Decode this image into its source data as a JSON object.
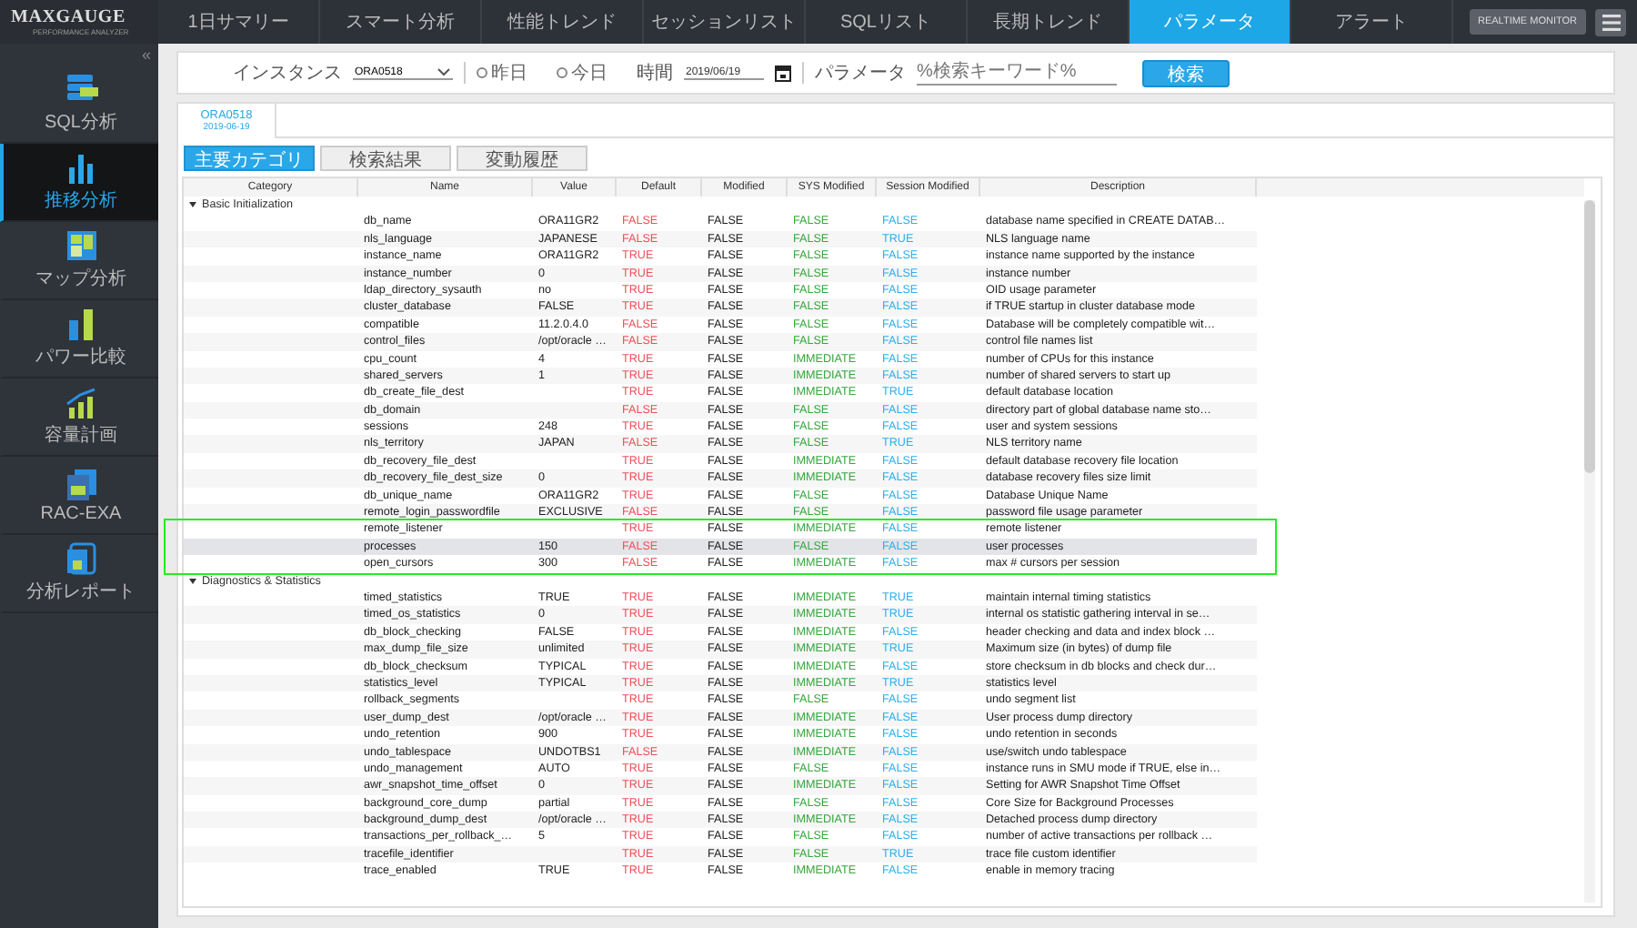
{
  "logo": {
    "title": "MAXGAUGE",
    "subtitle": "PERFORMANCE ANALYZER"
  },
  "nav": [
    {
      "label": "1日サマリー",
      "selected": false
    },
    {
      "label": "スマート分析",
      "selected": false
    },
    {
      "label": "性能トレンド",
      "selected": false
    },
    {
      "label": "セッションリスト",
      "selected": false
    },
    {
      "label": "SQLリスト",
      "selected": false
    },
    {
      "label": "長期トレンド",
      "selected": false
    },
    {
      "label": "パラメータ",
      "selected": true
    },
    {
      "label": "アラート",
      "selected": false
    }
  ],
  "realtime_button": "REALTIME MONITOR",
  "collapse": "«",
  "sidebar": [
    {
      "label": "SQL分析",
      "kind": "sql",
      "selected": false
    },
    {
      "label": "推移分析",
      "kind": "bars",
      "selected": true
    },
    {
      "label": "マップ分析",
      "kind": "map",
      "selected": false
    },
    {
      "label": "パワー比較",
      "kind": "compare",
      "selected": false
    },
    {
      "label": "容量計画",
      "kind": "growth",
      "selected": false
    },
    {
      "label": "RAC-EXA",
      "kind": "rac",
      "selected": false
    },
    {
      "label": "分析レポート",
      "kind": "report",
      "selected": false
    }
  ],
  "filter": {
    "instance_label": "インスタンス",
    "instance_value": "ORA0518",
    "radios": [
      {
        "label": "昨日",
        "checked": false
      },
      {
        "label": "今日",
        "checked": false
      }
    ],
    "time_label": "時間",
    "time_value": "2019/06/19",
    "param_label": "パラメータ",
    "param_placeholder": "%検索キーワード%",
    "search_button": "検索"
  },
  "instance_tab": {
    "name": "ORA0518",
    "date": "2019-06-19"
  },
  "subtabs": [
    {
      "label": "主要カテゴリ",
      "selected": true
    },
    {
      "label": "検索結果",
      "selected": false
    },
    {
      "label": "変動履歴",
      "selected": false
    }
  ],
  "table": {
    "columns": [
      "Category",
      "Name",
      "Value",
      "Default",
      "Modified",
      "SYS Modified",
      "Session Modified",
      "Description"
    ],
    "groups": [
      {
        "label": "Basic Initialization",
        "expanded": true,
        "rows": [
          {
            "name": "db_name",
            "value": "ORA11GR2",
            "default": "FALSE",
            "modified": "FALSE",
            "sys": "FALSE",
            "session": "FALSE",
            "description": "database name specified in CREATE DATAB…",
            "selected": false,
            "highlighted": false
          },
          {
            "name": "nls_language",
            "value": "JAPANESE",
            "default": "FALSE",
            "modified": "FALSE",
            "sys": "FALSE",
            "session": "TRUE",
            "description": "NLS language name",
            "selected": false,
            "highlighted": false
          },
          {
            "name": "instance_name",
            "value": "ORA11GR2",
            "default": "TRUE",
            "modified": "FALSE",
            "sys": "FALSE",
            "session": "FALSE",
            "description": "instance name supported by the instance",
            "selected": false,
            "highlighted": false
          },
          {
            "name": "instance_number",
            "value": "0",
            "default": "TRUE",
            "modified": "FALSE",
            "sys": "FALSE",
            "session": "FALSE",
            "description": "instance number",
            "selected": false,
            "highlighted": false
          },
          {
            "name": "ldap_directory_sysauth",
            "value": "no",
            "default": "TRUE",
            "modified": "FALSE",
            "sys": "FALSE",
            "session": "FALSE",
            "description": "OID usage parameter",
            "selected": false,
            "highlighted": false
          },
          {
            "name": "cluster_database",
            "value": "FALSE",
            "default": "TRUE",
            "modified": "FALSE",
            "sys": "FALSE",
            "session": "FALSE",
            "description": "if TRUE startup in cluster database mode",
            "selected": false,
            "highlighted": false
          },
          {
            "name": "compatible",
            "value": "11.2.0.4.0",
            "default": "FALSE",
            "modified": "FALSE",
            "sys": "FALSE",
            "session": "FALSE",
            "description": "Database will be completely compatible wit…",
            "selected": false,
            "highlighted": false
          },
          {
            "name": "control_files",
            "value": "/opt/oracle …",
            "default": "FALSE",
            "modified": "FALSE",
            "sys": "FALSE",
            "session": "FALSE",
            "description": "control file names list",
            "selected": false,
            "highlighted": false
          },
          {
            "name": "cpu_count",
            "value": "4",
            "default": "TRUE",
            "modified": "FALSE",
            "sys": "IMMEDIATE",
            "session": "FALSE",
            "description": "number of CPUs for this instance",
            "selected": false,
            "highlighted": false
          },
          {
            "name": "shared_servers",
            "value": "1",
            "default": "TRUE",
            "modified": "FALSE",
            "sys": "IMMEDIATE",
            "session": "FALSE",
            "description": "number of shared servers to start up",
            "selected": false,
            "highlighted": false
          },
          {
            "name": "db_create_file_dest",
            "value": "",
            "default": "TRUE",
            "modified": "FALSE",
            "sys": "IMMEDIATE",
            "session": "TRUE",
            "description": "default database location",
            "selected": false,
            "highlighted": false
          },
          {
            "name": "db_domain",
            "value": "",
            "default": "FALSE",
            "modified": "FALSE",
            "sys": "FALSE",
            "session": "FALSE",
            "description": "directory part of global database name sto…",
            "selected": false,
            "highlighted": false
          },
          {
            "name": "sessions",
            "value": "248",
            "default": "TRUE",
            "modified": "FALSE",
            "sys": "FALSE",
            "session": "FALSE",
            "description": "user and system sessions",
            "selected": false,
            "highlighted": false
          },
          {
            "name": "nls_territory",
            "value": "JAPAN",
            "default": "FALSE",
            "modified": "FALSE",
            "sys": "FALSE",
            "session": "TRUE",
            "description": "NLS territory name",
            "selected": false,
            "highlighted": false
          },
          {
            "name": "db_recovery_file_dest",
            "value": "",
            "default": "TRUE",
            "modified": "FALSE",
            "sys": "IMMEDIATE",
            "session": "FALSE",
            "description": "default database recovery file location",
            "selected": false,
            "highlighted": false
          },
          {
            "name": "db_recovery_file_dest_size",
            "value": "0",
            "default": "TRUE",
            "modified": "FALSE",
            "sys": "IMMEDIATE",
            "session": "FALSE",
            "description": "database recovery files size limit",
            "selected": false,
            "highlighted": false
          },
          {
            "name": "db_unique_name",
            "value": "ORA11GR2",
            "default": "TRUE",
            "modified": "FALSE",
            "sys": "FALSE",
            "session": "FALSE",
            "description": "Database Unique Name",
            "selected": false,
            "highlighted": false
          },
          {
            "name": "remote_login_passwordfile",
            "value": "EXCLUSIVE",
            "default": "FALSE",
            "modified": "FALSE",
            "sys": "FALSE",
            "session": "FALSE",
            "description": "password file usage parameter",
            "selected": false,
            "highlighted": false
          },
          {
            "name": "remote_listener",
            "value": "",
            "default": "TRUE",
            "modified": "FALSE",
            "sys": "IMMEDIATE",
            "session": "FALSE",
            "description": "remote listener",
            "selected": false,
            "highlighted": true
          },
          {
            "name": "processes",
            "value": "150",
            "default": "FALSE",
            "modified": "FALSE",
            "sys": "FALSE",
            "session": "FALSE",
            "description": "user processes",
            "selected": true,
            "highlighted": true
          },
          {
            "name": "open_cursors",
            "value": "300",
            "default": "FALSE",
            "modified": "FALSE",
            "sys": "IMMEDIATE",
            "session": "FALSE",
            "description": "max # cursors per session",
            "selected": false,
            "highlighted": true
          }
        ]
      },
      {
        "label": "Diagnostics & Statistics",
        "expanded": true,
        "rows": [
          {
            "name": "timed_statistics",
            "value": "TRUE",
            "default": "TRUE",
            "modified": "FALSE",
            "sys": "IMMEDIATE",
            "session": "TRUE",
            "description": "maintain internal timing statistics",
            "selected": false,
            "highlighted": false
          },
          {
            "name": "timed_os_statistics",
            "value": "0",
            "default": "TRUE",
            "modified": "FALSE",
            "sys": "IMMEDIATE",
            "session": "TRUE",
            "description": "internal os statistic gathering interval in se…",
            "selected": false,
            "highlighted": false
          },
          {
            "name": "db_block_checking",
            "value": "FALSE",
            "default": "TRUE",
            "modified": "FALSE",
            "sys": "IMMEDIATE",
            "session": "FALSE",
            "description": "header checking and data and index block …",
            "selected": false,
            "highlighted": false
          },
          {
            "name": "max_dump_file_size",
            "value": "unlimited",
            "default": "TRUE",
            "modified": "FALSE",
            "sys": "IMMEDIATE",
            "session": "TRUE",
            "description": "Maximum size (in bytes) of dump file",
            "selected": false,
            "highlighted": false
          },
          {
            "name": "db_block_checksum",
            "value": "TYPICAL",
            "default": "TRUE",
            "modified": "FALSE",
            "sys": "IMMEDIATE",
            "session": "FALSE",
            "description": "store checksum in db blocks and check dur…",
            "selected": false,
            "highlighted": false
          },
          {
            "name": "statistics_level",
            "value": "TYPICAL",
            "default": "TRUE",
            "modified": "FALSE",
            "sys": "IMMEDIATE",
            "session": "TRUE",
            "description": "statistics level",
            "selected": false,
            "highlighted": false
          },
          {
            "name": "rollback_segments",
            "value": "",
            "default": "TRUE",
            "modified": "FALSE",
            "sys": "FALSE",
            "session": "FALSE",
            "description": "undo segment list",
            "selected": false,
            "highlighted": false
          },
          {
            "name": "user_dump_dest",
            "value": "/opt/oracle …",
            "default": "TRUE",
            "modified": "FALSE",
            "sys": "IMMEDIATE",
            "session": "FALSE",
            "description": "User process dump directory",
            "selected": false,
            "highlighted": false
          },
          {
            "name": "undo_retention",
            "value": "900",
            "default": "TRUE",
            "modified": "FALSE",
            "sys": "IMMEDIATE",
            "session": "FALSE",
            "description": "undo retention in seconds",
            "selected": false,
            "highlighted": false
          },
          {
            "name": "undo_tablespace",
            "value": "UNDOTBS1",
            "default": "FALSE",
            "modified": "FALSE",
            "sys": "IMMEDIATE",
            "session": "FALSE",
            "description": "use/switch undo tablespace",
            "selected": false,
            "highlighted": false
          },
          {
            "name": "undo_management",
            "value": "AUTO",
            "default": "TRUE",
            "modified": "FALSE",
            "sys": "FALSE",
            "session": "FALSE",
            "description": "instance runs in SMU mode if TRUE, else in…",
            "selected": false,
            "highlighted": false
          },
          {
            "name": "awr_snapshot_time_offset",
            "value": "0",
            "default": "TRUE",
            "modified": "FALSE",
            "sys": "IMMEDIATE",
            "session": "FALSE",
            "description": "Setting for AWR Snapshot Time Offset",
            "selected": false,
            "highlighted": false
          },
          {
            "name": "background_core_dump",
            "value": "partial",
            "default": "TRUE",
            "modified": "FALSE",
            "sys": "FALSE",
            "session": "FALSE",
            "description": "Core Size for Background Processes",
            "selected": false,
            "highlighted": false
          },
          {
            "name": "background_dump_dest",
            "value": "/opt/oracle …",
            "default": "TRUE",
            "modified": "FALSE",
            "sys": "IMMEDIATE",
            "session": "FALSE",
            "description": "Detached process dump directory",
            "selected": false,
            "highlighted": false
          },
          {
            "name": "transactions_per_rollback_…",
            "value": "5",
            "default": "TRUE",
            "modified": "FALSE",
            "sys": "FALSE",
            "session": "FALSE",
            "description": "number of active transactions per rollback …",
            "selected": false,
            "highlighted": false
          },
          {
            "name": "tracefile_identifier",
            "value": "",
            "default": "TRUE",
            "modified": "FALSE",
            "sys": "FALSE",
            "session": "TRUE",
            "description": "trace file custom identifier",
            "selected": false,
            "highlighted": false
          },
          {
            "name": "trace_enabled",
            "value": "TRUE",
            "default": "TRUE",
            "modified": "FALSE",
            "sys": "IMMEDIATE",
            "session": "FALSE",
            "description": "enable in memory tracing",
            "selected": false,
            "highlighted": false
          }
        ]
      }
    ]
  }
}
